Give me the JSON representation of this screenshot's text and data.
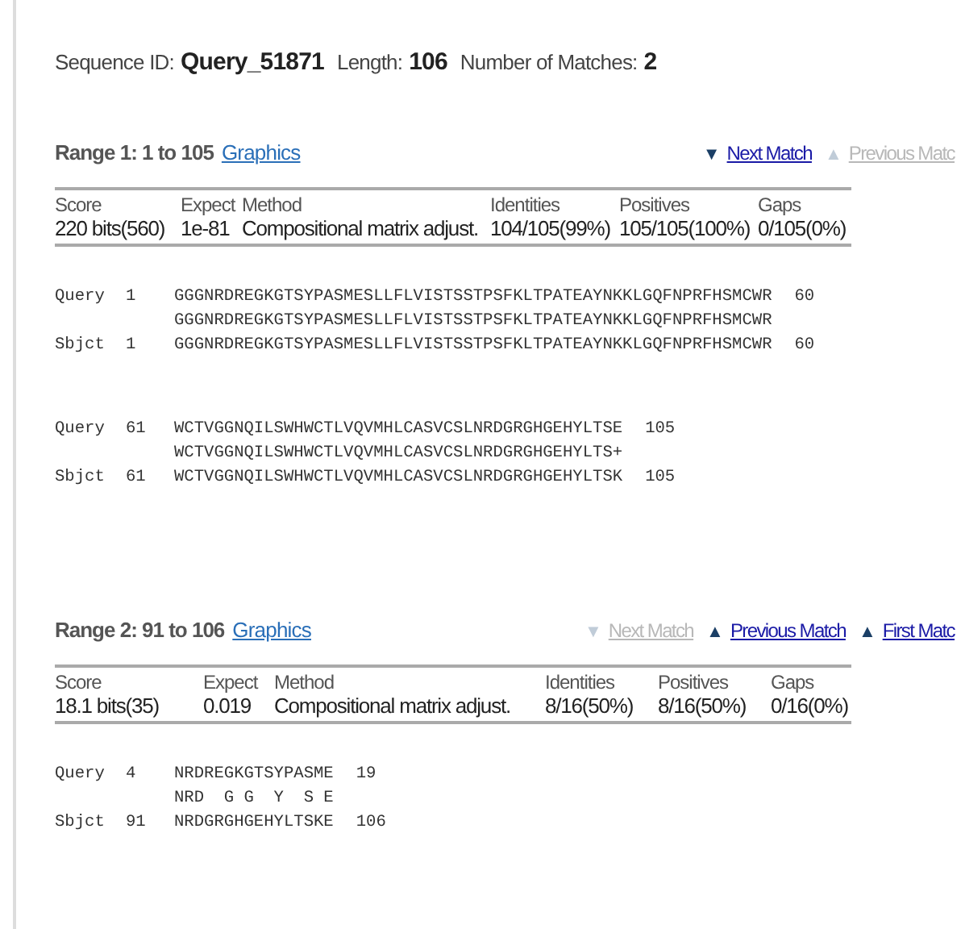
{
  "sequence_info": [
    {
      "label": "Sequence ID:",
      "value": "Query_51871"
    },
    {
      "label": "Length:",
      "value": "106"
    },
    {
      "label": "Number of Matches:",
      "value": "2"
    }
  ],
  "ranges": [
    {
      "title": "Range 1: 1 to 105",
      "graphics_link": "Graphics",
      "nav": [
        {
          "arrow": "▼",
          "label": "Next Match",
          "disabled": false
        },
        {
          "arrow": "▲",
          "label": "Previous Matc",
          "disabled": true
        }
      ],
      "columns": [
        "Score",
        "Expect",
        "Method",
        "Identities",
        "Positives",
        "Gaps"
      ],
      "row": [
        "220 bits(560)",
        "1e-81",
        "Compositional matrix adjust.",
        "104/105(99%)",
        "105/105(100%)",
        "0/105(0%)"
      ],
      "blocks": [
        {
          "query": {
            "label": "Query",
            "start": "1",
            "seq": "GGGNRDREGKGTSYPASMESLLFLVISTSSTPSFKLTPATEAYNKKLGQFNPRFHSMCWR",
            "end": "60"
          },
          "match": "GGGNRDREGKGTSYPASMESLLFLVISTSSTPSFKLTPATEAYNKKLGQFNPRFHSMCWR",
          "sbjct": {
            "label": "Sbjct",
            "start": "1",
            "seq": "GGGNRDREGKGTSYPASMESLLFLVISTSSTPSFKLTPATEAYNKKLGQFNPRFHSMCWR",
            "end": "60"
          }
        },
        {
          "query": {
            "label": "Query",
            "start": "61",
            "seq": "WCTVGGNQILSWHWCTLVQVMHLCASVCSLNRDGRGHGEHYLTSE",
            "end": "105"
          },
          "match": "WCTVGGNQILSWHWCTLVQVMHLCASVCSLNRDGRGHGEHYLTS+",
          "sbjct": {
            "label": "Sbjct",
            "start": "61",
            "seq": "WCTVGGNQILSWHWCTLVQVMHLCASVCSLNRDGRGHGEHYLTSK",
            "end": "105"
          }
        }
      ]
    },
    {
      "title": "Range 2: 91 to 106",
      "graphics_link": "Graphics",
      "nav": [
        {
          "arrow": "▼",
          "label": "Next Match",
          "disabled": true
        },
        {
          "arrow": "▲",
          "label": "Previous Match",
          "disabled": false
        },
        {
          "arrow": "▲",
          "label": "First Matc",
          "disabled": false
        }
      ],
      "columns": [
        "Score",
        "Expect",
        "Method",
        "Identities",
        "Positives",
        "Gaps"
      ],
      "row": [
        "18.1 bits(35)",
        "0.019",
        "Compositional matrix adjust.",
        "8/16(50%)",
        "8/16(50%)",
        "0/16(0%)"
      ],
      "blocks": [
        {
          "query": {
            "label": "Query",
            "start": "4",
            "seq": "NRDREGKGTSYPASME",
            "end": "19"
          },
          "match": "NRD  G G  Y  S E",
          "sbjct": {
            "label": "Sbjct",
            "start": "91",
            "seq": "NRDGRGHGEHYLTSKE",
            "end": "106"
          }
        }
      ]
    }
  ]
}
